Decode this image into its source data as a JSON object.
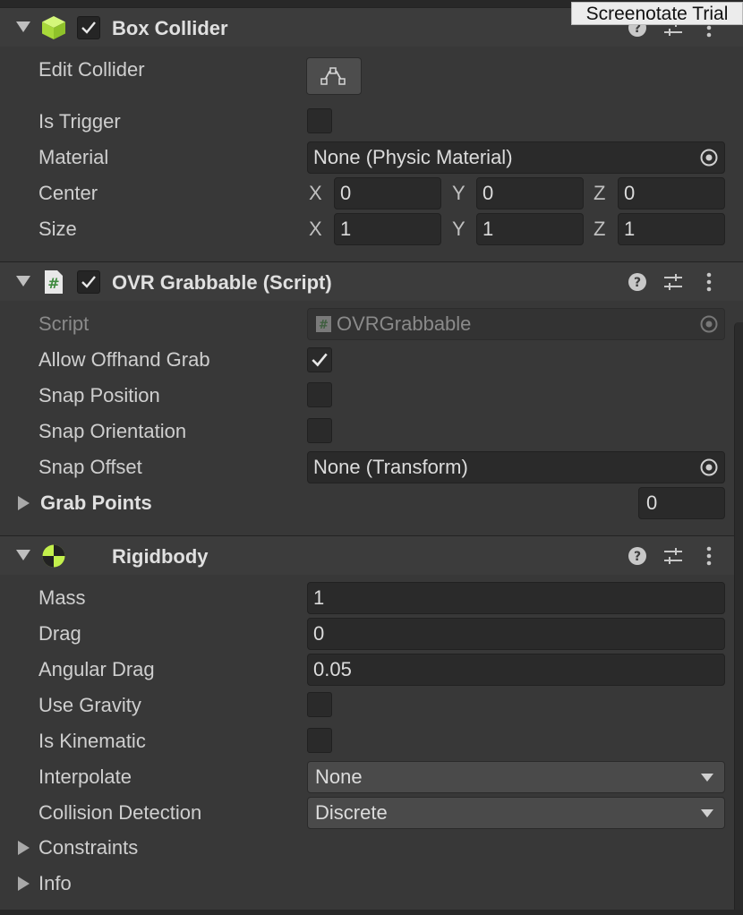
{
  "watermark": "Screenotate Trial",
  "box_collider": {
    "title": "Box Collider",
    "edit_collider_label": "Edit Collider",
    "is_trigger_label": "Is Trigger",
    "material_label": "Material",
    "material_value": "None (Physic Material)",
    "center_label": "Center",
    "center": {
      "x": "0",
      "y": "0",
      "z": "0"
    },
    "size_label": "Size",
    "size": {
      "x": "1",
      "y": "1",
      "z": "1"
    },
    "axis": {
      "x": "X",
      "y": "Y",
      "z": "Z"
    }
  },
  "ovr_grabbable": {
    "title": "OVR Grabbable (Script)",
    "script_label": "Script",
    "script_value": "OVRGrabbable",
    "allow_offhand_label": "Allow Offhand Grab",
    "allow_offhand_checked": true,
    "snap_position_label": "Snap Position",
    "snap_orientation_label": "Snap Orientation",
    "snap_offset_label": "Snap Offset",
    "snap_offset_value": "None (Transform)",
    "grab_points_label": "Grab Points",
    "grab_points_count": "0"
  },
  "rigidbody": {
    "title": "Rigidbody",
    "mass_label": "Mass",
    "mass_value": "1",
    "drag_label": "Drag",
    "drag_value": "0",
    "angular_drag_label": "Angular Drag",
    "angular_drag_value": "0.05",
    "use_gravity_label": "Use Gravity",
    "is_kinematic_label": "Is Kinematic",
    "interpolate_label": "Interpolate",
    "interpolate_value": "None",
    "collision_detection_label": "Collision Detection",
    "collision_detection_value": "Discrete",
    "constraints_label": "Constraints",
    "info_label": "Info"
  },
  "colors": {
    "background": "#383838",
    "header": "#3c3c3c",
    "field": "#2a2a2a",
    "accent_green": "#c3f04c"
  },
  "icons": [
    "foldout-arrow-icon",
    "box-collider-icon",
    "checkmark-icon",
    "help-icon",
    "preset-sliders-icon",
    "kebab-menu-icon",
    "script-hash-icon",
    "rigidbody-icon",
    "object-picker-icon",
    "edit-collider-icon",
    "dropdown-arrow-icon"
  ]
}
